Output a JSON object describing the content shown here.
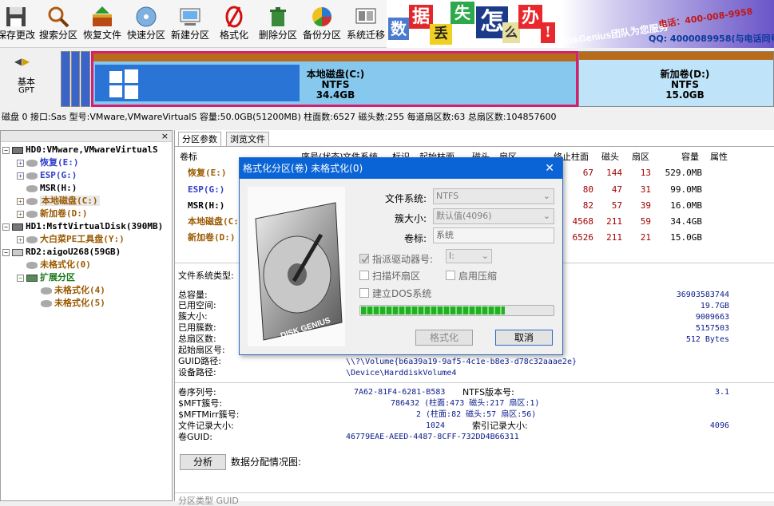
{
  "toolbar": {
    "items": [
      {
        "label": "保存更改",
        "icon": "floppy-icon"
      },
      {
        "label": "搜索分区",
        "icon": "magnifier-icon"
      },
      {
        "label": "恢复文件",
        "icon": "restore-box-icon"
      },
      {
        "label": "快速分区",
        "icon": "disc-icon"
      },
      {
        "label": "新建分区",
        "icon": "monitor-icon"
      },
      {
        "label": "格式化",
        "icon": "no-format-icon"
      },
      {
        "label": "删除分区",
        "icon": "trash-icon"
      },
      {
        "label": "备份分区",
        "icon": "backup-pie-icon"
      },
      {
        "label": "系统迁移",
        "icon": "migrate-icon"
      }
    ]
  },
  "banner": {
    "chars": [
      "数",
      "据",
      "丢",
      "失",
      "怎",
      "么",
      "办",
      "!"
    ],
    "brand": "DiskGenius团队为您服务",
    "phone": "电话：400-008-9958",
    "qq": "QQ: 4000089958(与电话同号)"
  },
  "nav": {
    "basic": "基本",
    "gpt": "GPT"
  },
  "partition_bar": {
    "c_name": "本地磁盘(C:)",
    "c_fs": "NTFS",
    "c_size": "34.4GB",
    "d_name": "新加卷(D:)",
    "d_fs": "NTFS",
    "d_size": "15.0GB"
  },
  "diskinfo": "磁盘 0 接口:Sas  型号:VMware,VMwareVirtualS  容量:50.0GB(51200MB)  柱面数:6527  磁头数:255  每道扇区数:63  总扇区数:104857600",
  "tree": {
    "close": "×",
    "items": [
      {
        "label": "HD0:VMware,VMwareVirtualS",
        "color": "#000000"
      },
      {
        "label": "恢复(E:)",
        "color": "#2f3fc9"
      },
      {
        "label": "ESP(G:)",
        "color": "#2f3fc9"
      },
      {
        "label": "MSR(H:)",
        "color": "#000000"
      },
      {
        "label": "本地磁盘(C:)",
        "color": "#9a5a00"
      },
      {
        "label": "新加卷(D:)",
        "color": "#9a5a00"
      },
      {
        "label": "HD1:MsftVirtualDisk(390MB)",
        "color": "#000000"
      },
      {
        "label": "大白菜PE工具盘(Y:)",
        "color": "#9a5a00"
      },
      {
        "label": "RD2:aigoU268(59GB)",
        "color": "#000000"
      },
      {
        "label": "未格式化(0)",
        "color": "#9a5a00"
      },
      {
        "label": "扩展分区",
        "color": "#1a7a1a"
      },
      {
        "label": "未格式化(4)",
        "color": "#9a5a00"
      },
      {
        "label": "未格式化(5)",
        "color": "#9a5a00"
      }
    ]
  },
  "tabs": [
    "分区参数",
    "浏览文件"
  ],
  "table": {
    "headers": [
      "卷标",
      "序号(状态)",
      "文件系统",
      "标识",
      "起始柱面",
      "磁头",
      "扇区",
      "终止柱面",
      "磁头",
      "扇区",
      "容量",
      "属性"
    ],
    "rows": [
      {
        "name": "恢复(E:)",
        "end_cyl": "67",
        "head": "144",
        "sector": "13",
        "size": "529.0MB"
      },
      {
        "name": "ESP(G:)",
        "end_cyl": "80",
        "head": "47",
        "sector": "31",
        "size": "99.0MB"
      },
      {
        "name": "MSR(H:)",
        "end_cyl": "82",
        "head": "57",
        "sector": "39",
        "size": "16.0MB"
      },
      {
        "name": "本地磁盘(C:)",
        "end_cyl": "4568",
        "head": "211",
        "sector": "59",
        "size": "34.4GB"
      },
      {
        "name": "新加卷(D:)",
        "end_cyl": "6526",
        "head": "211",
        "sector": "21",
        "size": "15.0GB"
      }
    ]
  },
  "details": {
    "fs_type_label": "文件系统类型:",
    "left_labels": [
      "总容量:",
      "已用空间:",
      "簇大小:",
      "已用簇数:",
      "总扇区数:",
      "起始扇区号:",
      "GUID路径:",
      "设备路径:"
    ],
    "right_values": [
      "36903583744",
      "19.7GB",
      "9009663",
      "5157503",
      "512 Bytes"
    ],
    "guid_path": "\\\\?\\Volume{b6a39a19-9af5-4c1e-b8e3-d78c32aaae2e}",
    "device_path": "\\Device\\HarddiskVolume4",
    "ntfs_labels": [
      "卷序列号:",
      "$MFT簇号:",
      "$MFTMirr簇号:",
      "文件记录大小:",
      "卷GUID:"
    ],
    "serial": "7A62-81F4-6281-B583",
    "ntfs_version_label": "NTFS版本号:",
    "ntfs_version": "3.1",
    "mft": "786432 (柱面:473 磁头:217 扇区:1)",
    "mftmirr": "2 (柱面:82 磁头:57 扇区:56)",
    "record_size": "1024",
    "index_label": "索引记录大小:",
    "index_size": "4096",
    "vol_guid": "46779EAE-AEED-4487-8CFF-732DD4B66311",
    "analyze": "分析",
    "distribution": "数据分配情况图:",
    "bottom": "分区类型 GUID"
  },
  "dialog": {
    "title": "格式化分区(卷) 未格式化(0)",
    "close": "✕",
    "fs_label": "文件系统:",
    "fs_value": "NTFS",
    "cluster_label": "簇大小:",
    "cluster_value": "默认值(4096)",
    "vol_label": "卷标:",
    "vol_value": "系统",
    "assign_label": "指派驱动器号:",
    "assign_value": "I:",
    "scan_label": "扫描坏扇区",
    "compress_label": "启用压缩",
    "dos_label": "建立DOS系统",
    "progress": 0.75,
    "format_btn": "格式化",
    "cancel_btn": "取消",
    "art_text": "DISK GENIUS"
  }
}
